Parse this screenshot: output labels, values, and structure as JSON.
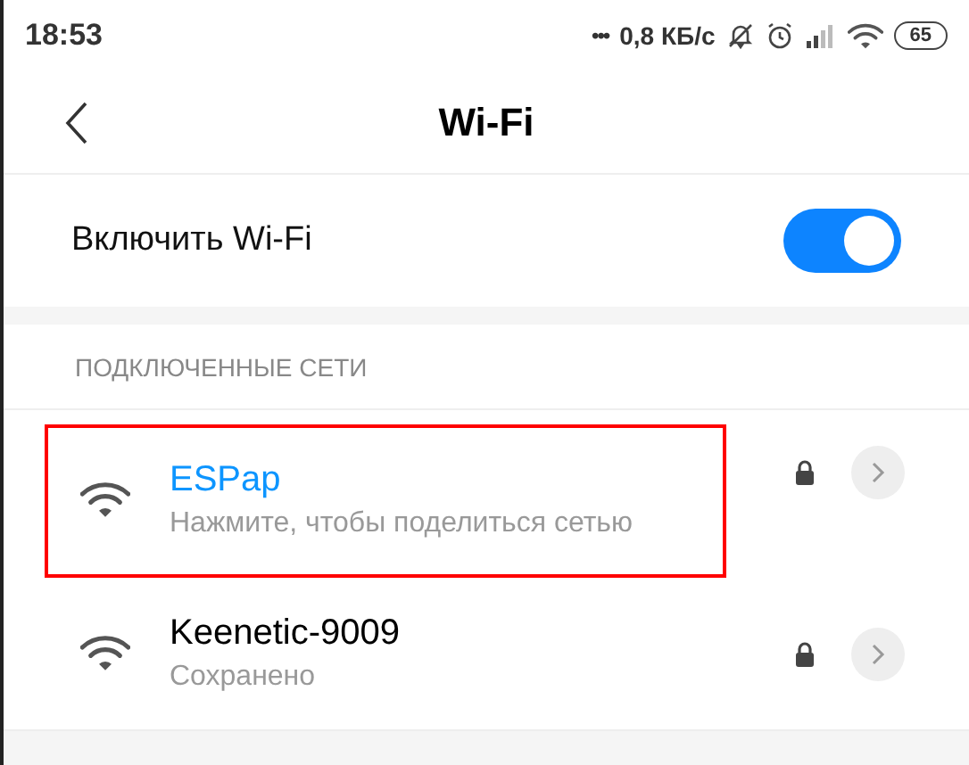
{
  "status_bar": {
    "time": "18:53",
    "more": "•••",
    "speed": "0,8 КБ/с",
    "battery": "65"
  },
  "header": {
    "title": "Wi-Fi"
  },
  "wifi_toggle": {
    "label": "Включить Wi-Fi",
    "on": true
  },
  "section": {
    "title": "ПОДКЛЮЧЕННЫЕ СЕТИ"
  },
  "networks": [
    {
      "name": "ESPap",
      "status": "Нажмите, чтобы поделиться сетью",
      "connected": true,
      "highlighted": true
    },
    {
      "name": "Keenetic-9009",
      "status": "Сохранено",
      "connected": false,
      "highlighted": false
    }
  ]
}
